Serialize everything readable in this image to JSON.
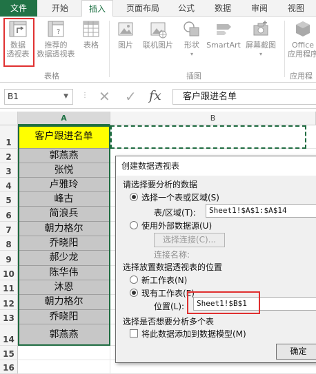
{
  "ribbon": {
    "tabs": [
      "文件",
      "开始",
      "插入",
      "页面布局",
      "公式",
      "数据",
      "审阅",
      "视图"
    ],
    "active_tab": "插入",
    "buttons": {
      "pivot_line1": "数据",
      "pivot_line2": "透视表",
      "recommended_line1": "推荐的",
      "recommended_line2": "数据透视表",
      "table": "表格",
      "picture": "图片",
      "online_picture": "联机图片",
      "shapes": "形状",
      "smartart": "SmartArt",
      "screenshot": "屏幕截图",
      "office_line1": "Office",
      "office_line2": "应用程序"
    },
    "groups": {
      "tables": "表格",
      "illustrations": "插图",
      "apps": "应用程"
    }
  },
  "formula_bar": {
    "name_box": "B1",
    "content": "客户跟进名单"
  },
  "grid": {
    "columns": [
      "A",
      "B"
    ],
    "rows": [
      "1",
      "2",
      "3",
      "4",
      "5",
      "6",
      "7",
      "8",
      "9",
      "10",
      "11",
      "12",
      "13",
      "14",
      "15",
      "16"
    ],
    "cells_A": [
      "客户跟进名单",
      "郭燕燕",
      "张悦",
      "卢雅玲",
      "峰古",
      "简浪兵",
      "朝力格尔",
      "乔晓阳",
      "郝少龙",
      "陈华伟",
      "沐恩",
      "朝力格尔",
      "乔晓阳",
      "郭燕燕"
    ]
  },
  "dialog": {
    "title": "创建数据透视表",
    "section_choose_data": "请选择要分析的数据",
    "radio_select_range": "选择一个表或区域(S)",
    "label_table_range": "表/区域(T):",
    "value_table_range": "Sheet1!$A$1:$A$14",
    "radio_external": "使用外部数据源(U)",
    "button_choose_connection": "选择连接(C)...",
    "label_connection_name": "连接名称:",
    "section_location": "选择放置数据透视表的位置",
    "radio_new_sheet": "新工作表(N)",
    "radio_existing_sheet": "现有工作表(E)",
    "label_location": "位置(L):",
    "value_location": "Sheet1!$B$1",
    "section_multi": "选择是否想要分析多个表",
    "checkbox_data_model": "将此数据添加到数据模型(M)",
    "ok_button": "确定"
  },
  "colors": {
    "excel_green": "#217346",
    "highlight_red": "#e03030",
    "header_yellow": "#ffff00",
    "selection_gray": "#c7c7c7"
  }
}
